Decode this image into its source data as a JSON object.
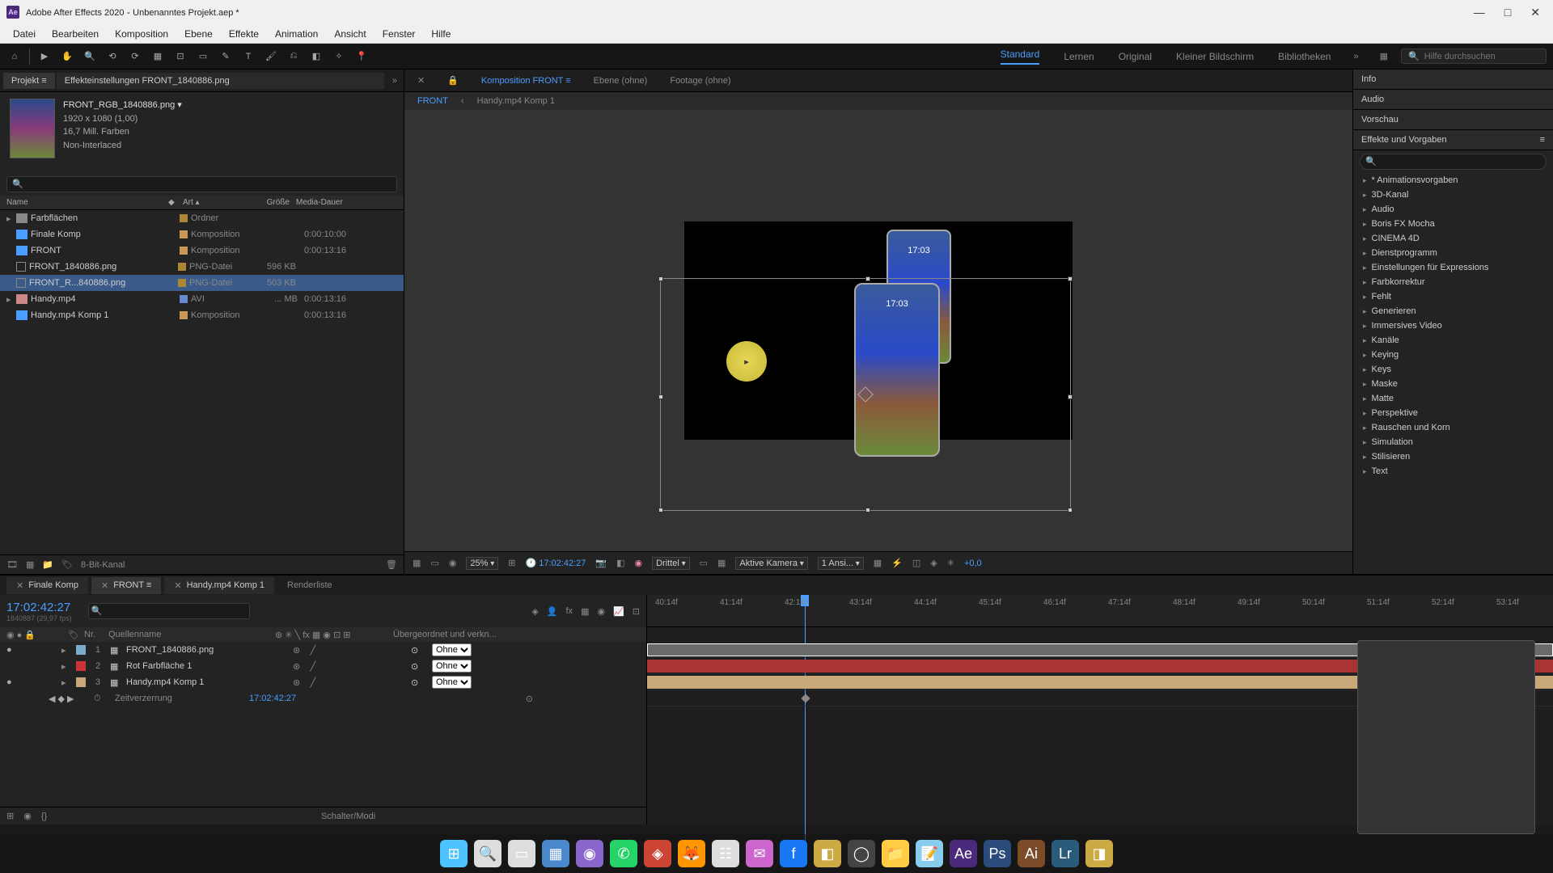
{
  "titlebar": {
    "app": "Adobe After Effects 2020",
    "project": "Unbenanntes Projekt.aep *"
  },
  "menu": [
    "Datei",
    "Bearbeiten",
    "Komposition",
    "Ebene",
    "Effekte",
    "Animation",
    "Ansicht",
    "Fenster",
    "Hilfe"
  ],
  "workspaces": {
    "items": [
      "Standard",
      "Lernen",
      "Original",
      "Kleiner Bildschirm",
      "Bibliotheken"
    ],
    "active": "Standard"
  },
  "search_help_placeholder": "Hilfe durchsuchen",
  "project_panel": {
    "tab": "Projekt",
    "effect_tab": "Effekteinstellungen  FRONT_1840886.png",
    "sel_name": "FRONT_RGB_1840886.png",
    "dims": "1920 x 1080 (1,00)",
    "colors": "16,7 Mill. Farben",
    "interlace": "Non-Interlaced",
    "cols": {
      "name": "Name",
      "art": "Art",
      "size": "Größe",
      "dur": "Media-Dauer"
    },
    "rows": [
      {
        "exp": "▸",
        "ic": "folder",
        "name": "Farbflächen",
        "lbl": "#aa8833",
        "art": "Ordner",
        "size": "",
        "dur": ""
      },
      {
        "exp": "",
        "ic": "comp",
        "name": "Finale Komp",
        "lbl": "#c89858",
        "art": "Komposition",
        "size": "",
        "dur": "0:00:10:00"
      },
      {
        "exp": "",
        "ic": "comp",
        "name": "FRONT",
        "lbl": "#c89858",
        "art": "Komposition",
        "size": "",
        "dur": "0:00:13:16"
      },
      {
        "exp": "",
        "ic": "png",
        "name": "FRONT_1840886.png",
        "lbl": "#aa8833",
        "art": "PNG-Datei",
        "size": "596 KB",
        "dur": ""
      },
      {
        "exp": "",
        "ic": "png",
        "name": "FRONT_R...840886.png",
        "lbl": "#aa8833",
        "art": "PNG-Datei",
        "size": "503 KB",
        "dur": "",
        "sel": true
      },
      {
        "exp": "▸",
        "ic": "avi",
        "name": "Handy.mp4",
        "lbl": "#6688cc",
        "art": "AVI",
        "size": "... MB",
        "dur": "0:00:13:16"
      },
      {
        "exp": "",
        "ic": "comp",
        "name": "Handy.mp4 Komp 1",
        "lbl": "#c89858",
        "art": "Komposition",
        "size": "",
        "dur": "0:00:13:16"
      }
    ],
    "bitdepth": "8-Bit-Kanal"
  },
  "comp_panel": {
    "tabs": [
      {
        "l": "Komposition FRONT",
        "sel": true
      },
      {
        "l": "Ebene (ohne)"
      },
      {
        "l": "Footage (ohne)"
      }
    ],
    "flow": {
      "cur": "FRONT",
      "back": "‹",
      "other": "Handy.mp4 Komp 1"
    },
    "phone_time": "17:03",
    "footer": {
      "zoom": "25%",
      "tc": "17:02:42:27",
      "res": "Drittel",
      "cam": "Aktive Kamera",
      "views": "1 Ansi...",
      "exp": "+0,0"
    }
  },
  "right_panels": {
    "info": "Info",
    "audio": "Audio",
    "preview": "Vorschau",
    "effects": "Effekte und Vorgaben",
    "items": [
      "* Animationsvorgaben",
      "3D-Kanal",
      "Audio",
      "Boris FX Mocha",
      "CINEMA 4D",
      "Dienstprogramm",
      "Einstellungen für Expressions",
      "Farbkorrektur",
      "Fehlt",
      "Generieren",
      "Immersives Video",
      "Kanäle",
      "Keying",
      "Keys",
      "Maske",
      "Matte",
      "Perspektive",
      "Rauschen und Korn",
      "Simulation",
      "Stilisieren",
      "Text"
    ]
  },
  "timeline": {
    "tabs": [
      {
        "l": "Finale Komp"
      },
      {
        "l": "FRONT",
        "sel": true
      },
      {
        "l": "Handy.mp4 Komp 1"
      },
      {
        "l": "Renderliste",
        "plain": true
      }
    ],
    "tc": "17:02:42:27",
    "frame": "1840887 (29,97 fps)",
    "head": {
      "nr": "Nr.",
      "src": "Quellenname",
      "parent": "Übergeordnet und verkn..."
    },
    "layers": [
      {
        "eye": "●",
        "num": "1",
        "lbl": "#7aaacc",
        "name": "FRONT_1840886.png",
        "parent": "Ohne",
        "bar": "b1",
        "sel": true
      },
      {
        "eye": "",
        "num": "2",
        "lbl": "#cc3333",
        "name": "Rot Farbfläche 1",
        "parent": "Ohne",
        "bar": "b2"
      },
      {
        "eye": "●",
        "num": "3",
        "lbl": "#c8a878",
        "name": "Handy.mp4 Komp 1",
        "parent": "Ohne",
        "bar": "b3"
      }
    ],
    "prop": {
      "name": "Zeitverzerrung",
      "val": "17:02:42:27"
    },
    "ruler": [
      "40:14f",
      "41:14f",
      "42:14f",
      "43:14f",
      "44:14f",
      "45:14f",
      "46:14f",
      "47:14f",
      "48:14f",
      "49:14f",
      "50:14f",
      "51:14f",
      "52:14f",
      "53:14f"
    ],
    "footer": "Schalter/Modi"
  },
  "taskbar": [
    {
      "n": "windows",
      "c": "#4cc2ff",
      "t": "⊞"
    },
    {
      "n": "search",
      "c": "#ddd",
      "t": "🔍"
    },
    {
      "n": "taskview",
      "c": "#ddd",
      "t": "▭"
    },
    {
      "n": "explorer",
      "c": "#4a88cc",
      "t": "▦"
    },
    {
      "n": "app1",
      "c": "#8866cc",
      "t": "◉"
    },
    {
      "n": "whatsapp",
      "c": "#25d366",
      "t": "✆"
    },
    {
      "n": "app2",
      "c": "#cc4433",
      "t": "◈"
    },
    {
      "n": "firefox",
      "c": "#ff9500",
      "t": "🦊"
    },
    {
      "n": "app3",
      "c": "#ddd",
      "t": "☷"
    },
    {
      "n": "messenger",
      "c": "#cc66cc",
      "t": "✉"
    },
    {
      "n": "facebook",
      "c": "#1877f2",
      "t": "f"
    },
    {
      "n": "app4",
      "c": "#ccaa44",
      "t": "◧"
    },
    {
      "n": "obs",
      "c": "#444",
      "t": "◯"
    },
    {
      "n": "folder",
      "c": "#ffcc44",
      "t": "📁"
    },
    {
      "n": "notes",
      "c": "#88ccee",
      "t": "📝"
    },
    {
      "n": "ae",
      "c": "#4b2a7b",
      "t": "Ae"
    },
    {
      "n": "ps",
      "c": "#2a4b7b",
      "t": "Ps"
    },
    {
      "n": "ai",
      "c": "#7b4b2a",
      "t": "Ai"
    },
    {
      "n": "lr",
      "c": "#2a5b7b",
      "t": "Lr"
    },
    {
      "n": "app5",
      "c": "#ccaa44",
      "t": "◨"
    }
  ]
}
